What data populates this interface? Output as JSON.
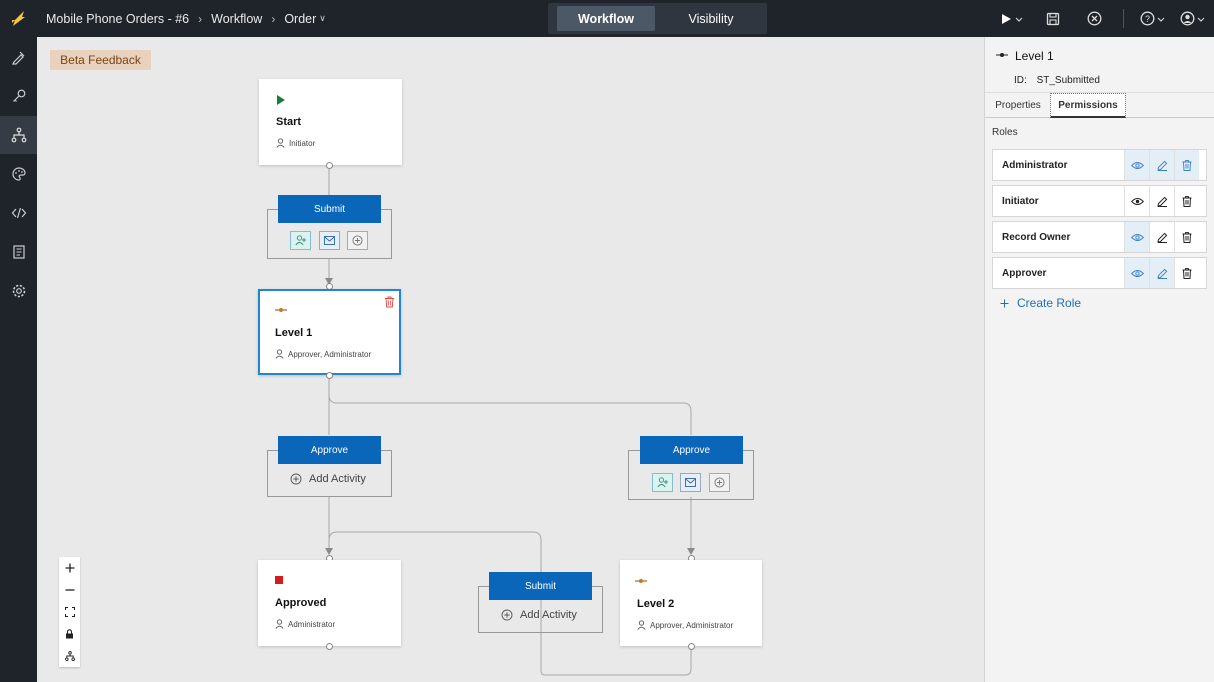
{
  "breadcrumb": {
    "app": "Mobile Phone Orders - #6",
    "section": "Workflow",
    "current": "Order"
  },
  "view_toggle": {
    "workflow": "Workflow",
    "visibility": "Visibility"
  },
  "colors": {
    "accent": "#0a66b8",
    "selected_border": "#2185d0",
    "topbar": "#1f242b",
    "beta_bg": "#e8d2bd",
    "delete_red": "#e0483e",
    "start_green": "#1e7a3c",
    "stop_red": "#d71920"
  },
  "toolbar_icons": [
    "play-icon",
    "save-icon",
    "close-circle-icon",
    "help-icon",
    "user-icon"
  ],
  "rail_icons": [
    "pen-ruler-icon",
    "key-icon",
    "workflow-icon",
    "palette-icon",
    "code-icon",
    "report-icon",
    "settings-icon"
  ],
  "canvas": {
    "beta_feedback": "Beta Feedback",
    "nodes": {
      "start": {
        "title": "Start",
        "roles": "Initiator"
      },
      "level1": {
        "title": "Level 1",
        "roles": "Approver, Administrator"
      },
      "approved": {
        "title": "Approved",
        "roles": "Administrator"
      },
      "level2": {
        "title": "Level 2",
        "roles": "Approver, Administrator"
      }
    },
    "actions": {
      "submit1": "Submit",
      "approve1": "Approve",
      "approve2": "Approve",
      "submit2": "Submit"
    },
    "add_activity": "Add Activity"
  },
  "panel": {
    "title": "Level 1",
    "id_label": "ID:",
    "id_value": "ST_Submitted",
    "tabs": {
      "properties": "Properties",
      "permissions": "Permissions"
    },
    "roles_label": "Roles",
    "roles": [
      {
        "name": "Administrator"
      },
      {
        "name": "Initiator"
      },
      {
        "name": "Record Owner"
      },
      {
        "name": "Approver"
      }
    ],
    "create_role": "Create Role"
  }
}
